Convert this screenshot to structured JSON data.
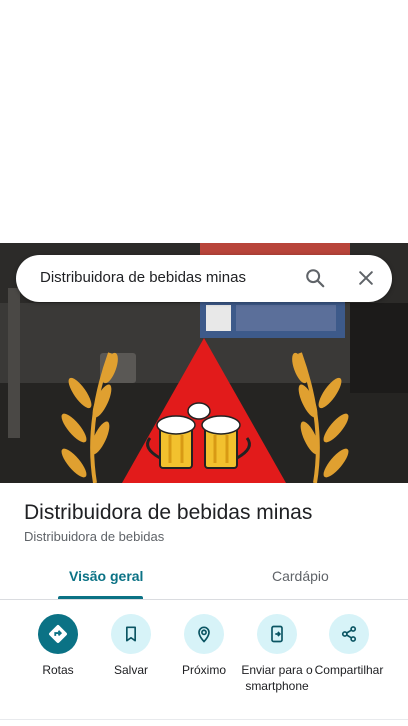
{
  "search": {
    "query": "Distribuidora de bebidas minas"
  },
  "place": {
    "title": "Distribuidora de bebidas minas",
    "category": "Distribuidora de bebidas"
  },
  "tabs": [
    {
      "label": "Visão geral",
      "active": true
    },
    {
      "label": "Cardápio",
      "active": false
    }
  ],
  "actions": [
    {
      "label": "Rotas",
      "icon": "directions-icon"
    },
    {
      "label": "Salvar",
      "icon": "bookmark-icon"
    },
    {
      "label": "Próximo",
      "icon": "nearby-icon"
    },
    {
      "label": "Enviar para o smartphone",
      "icon": "send-to-phone-icon"
    },
    {
      "label": "Compartilhar",
      "icon": "share-icon"
    }
  ],
  "colors": {
    "accent": "#0b7285",
    "action_background": "#d7f3f8",
    "logo_triangle": "#e21b1b",
    "wheat": "#e0a030"
  }
}
